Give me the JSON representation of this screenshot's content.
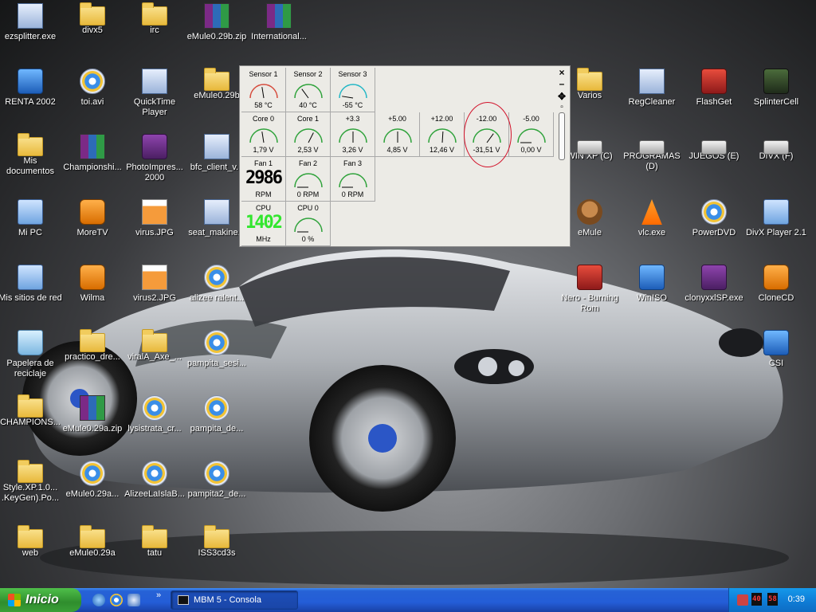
{
  "desktop_icons": [
    {
      "label": "ezsplitter.exe",
      "icon": "program-icon"
    },
    {
      "label": "divx5",
      "icon": "folder-icon"
    },
    {
      "label": "irc",
      "icon": "folder-icon"
    },
    {
      "label": "eMule0.29b.zip",
      "icon": "winrar-archive-icon"
    },
    {
      "label": "International...",
      "icon": "winrar-archive-icon"
    },
    {
      "label": "RENTA 2002",
      "icon": "renta-app-icon"
    },
    {
      "label": "toi.avi",
      "icon": "media-file-icon"
    },
    {
      "label": "QuickTime Player",
      "icon": "quicktime-icon"
    },
    {
      "label": "eMule0.29b",
      "icon": "folder-icon"
    },
    {
      "label": "Mis documentos",
      "icon": "my-documents-icon"
    },
    {
      "label": "Championshi...",
      "icon": "winrar-archive-icon"
    },
    {
      "label": "PhotoImpres... 2000",
      "icon": "photoimpression-icon"
    },
    {
      "label": "bfc_client_v...",
      "icon": "program-icon"
    },
    {
      "label": "Mi PC",
      "icon": "my-computer-icon"
    },
    {
      "label": "MoreTV",
      "icon": "app-icon"
    },
    {
      "label": "virus.JPG",
      "icon": "image-file-icon"
    },
    {
      "label": "seat_makine...",
      "icon": "document-icon"
    },
    {
      "label": "Mis sitios de red",
      "icon": "network-places-icon"
    },
    {
      "label": "Wilma",
      "icon": "app-icon"
    },
    {
      "label": "virus2.JPG",
      "icon": "image-file-icon"
    },
    {
      "label": "alizee ralent...",
      "icon": "media-file-icon"
    },
    {
      "label": "Papelera de reciclaje",
      "icon": "recycle-bin-icon"
    },
    {
      "label": "practico_dre...",
      "icon": "folder-icon"
    },
    {
      "label": "viralA_Axe_...",
      "icon": "folder-icon"
    },
    {
      "label": "pampita_sesi...",
      "icon": "media-file-icon"
    },
    {
      "label": "CHAMPIONS...",
      "icon": "folder-icon"
    },
    {
      "label": "eMule0.29a.zip",
      "icon": "winrar-archive-icon"
    },
    {
      "label": "lysistrata_cr...",
      "icon": "media-file-icon"
    },
    {
      "label": "pampita_de...",
      "icon": "media-file-icon"
    },
    {
      "label": "Style.XP.1.0... .KeyGen).Po...",
      "icon": "folder-icon"
    },
    {
      "label": "eMule0.29a...",
      "icon": "emule-setup-icon"
    },
    {
      "label": "AlizeeLaIslaB...",
      "icon": "media-file-icon"
    },
    {
      "label": "pampita2_de...",
      "icon": "media-file-icon"
    },
    {
      "label": "web",
      "icon": "folder-icon"
    },
    {
      "label": "eMule0.29a",
      "icon": "folder-icon"
    },
    {
      "label": "tatu",
      "icon": "folder-icon"
    },
    {
      "label": "ISS3cd3s",
      "icon": "folder-icon"
    },
    {
      "label": "Varios",
      "icon": "folder-icon"
    },
    {
      "label": "RegCleaner",
      "icon": "regcleaner-icon"
    },
    {
      "label": "FlashGet",
      "icon": "flashget-icon"
    },
    {
      "label": "SplinterCell",
      "icon": "splintercell-icon"
    },
    {
      "label": "WIN XP (C)",
      "icon": "hard-drive-icon"
    },
    {
      "label": "PROGRAMAS (D)",
      "icon": "hard-drive-icon"
    },
    {
      "label": "JUEGOS (E)",
      "icon": "hard-drive-icon"
    },
    {
      "label": "DIVX (F)",
      "icon": "hard-drive-icon"
    },
    {
      "label": "eMule",
      "icon": "emule-icon"
    },
    {
      "label": "vlc.exe",
      "icon": "vlc-icon"
    },
    {
      "label": "PowerDVD",
      "icon": "powerdvd-icon"
    },
    {
      "label": "DivX Player 2.1",
      "icon": "divx-player-icon"
    },
    {
      "label": "Nero - Burning Rom",
      "icon": "nero-icon"
    },
    {
      "label": "WinISO",
      "icon": "winiso-icon"
    },
    {
      "label": "clonyxxlSP.exe",
      "icon": "clonyxxl-icon"
    },
    {
      "label": "CloneCD",
      "icon": "clonecd-icon"
    },
    {
      "label": "CSI",
      "icon": "csi-icon"
    }
  ],
  "monitor": {
    "cells": [
      {
        "title": "Sensor 1",
        "value": "58 °C",
        "kind": "gauge",
        "level": 0.45,
        "arc": "#d64b3c"
      },
      {
        "title": "Sensor 2",
        "value": "40 °C",
        "kind": "gauge",
        "level": 0.3,
        "arc": "#2ea23a"
      },
      {
        "title": "Sensor 3",
        "value": "-55 °C",
        "kind": "gauge",
        "level": 0.05,
        "arc": "#23b7c6"
      },
      {
        "title": "Core 0",
        "value": "1,79 V",
        "kind": "gauge",
        "level": 0.45,
        "arc": "#2ea23a"
      },
      {
        "title": "Core 1",
        "value": "2,53 V",
        "kind": "gauge",
        "level": 0.65,
        "arc": "#2ea23a"
      },
      {
        "title": "+3.3",
        "value": "3,26 V",
        "kind": "gauge",
        "level": 0.5,
        "arc": "#2ea23a"
      },
      {
        "title": "+5.00",
        "value": "4,85 V",
        "kind": "gauge",
        "level": 0.5,
        "arc": "#2ea23a"
      },
      {
        "title": "+12.00",
        "value": "12,46 V",
        "kind": "gauge",
        "level": 0.52,
        "arc": "#2ea23a"
      },
      {
        "title": "-12.00",
        "value": "-31,51 V",
        "kind": "gauge",
        "level": 0.7,
        "arc": "#2ea23a"
      },
      {
        "title": "-5.00",
        "value": "0,00 V",
        "kind": "gauge",
        "level": 0.0,
        "arc": "#2ea23a"
      },
      {
        "title": "Fan 1",
        "value": "RPM",
        "kind": "lcd",
        "lcd": "2986",
        "lcd_color": "dark"
      },
      {
        "title": "Fan 2",
        "value": "0 RPM",
        "kind": "gauge",
        "level": 0.0,
        "arc": "#2ea23a"
      },
      {
        "title": "Fan 3",
        "value": "0 RPM",
        "kind": "gauge",
        "level": 0.0,
        "arc": "#2ea23a"
      },
      {
        "title": "CPU",
        "value": "MHz",
        "kind": "lcd",
        "lcd": "1402",
        "lcd_color": "lime"
      },
      {
        "title": "CPU 0",
        "value": "0 %",
        "kind": "gauge",
        "level": 0.0,
        "arc": "#2ea23a"
      }
    ],
    "highlighted_cell": "-12.00"
  },
  "taskbar": {
    "start_label": "Inicio",
    "quicklaunch_more": "»",
    "task_label": "MBM 5 - Consola",
    "tray_temp1": "40",
    "tray_temp2": "58",
    "clock": "0:39"
  },
  "colors": {
    "taskbar": "#245dd7",
    "start_button": "#3a9f37",
    "tray": "#0f7fd8",
    "highlight_circle": "#d2122a"
  }
}
